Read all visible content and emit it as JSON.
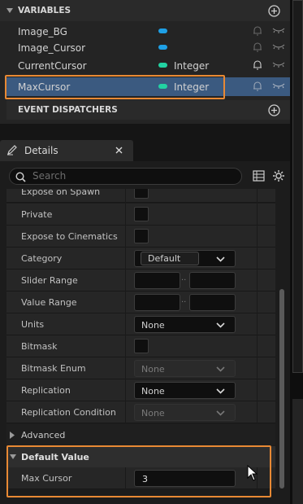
{
  "variables": {
    "header": "VARIABLES",
    "items": [
      {
        "name": "Image_BG",
        "type": "",
        "pill_color": "#1ea0e6"
      },
      {
        "name": "Image_Cursor",
        "type": "",
        "pill_color": "#1ea0e6"
      },
      {
        "name": "CurrentCursor",
        "type": "Integer",
        "pill_color": "#22d2a2"
      },
      {
        "name": "MaxCursor",
        "type": "Integer",
        "pill_color": "#22d2a2"
      }
    ]
  },
  "event_dispatchers": {
    "header": "EVENT DISPATCHERS"
  },
  "details": {
    "tab_label": "Details",
    "search_placeholder": "Search",
    "rows": {
      "expose_on_spawn": "Expose on Spawn",
      "private": "Private",
      "expose_to_cinematics": "Expose to Cinematics",
      "category": "Category",
      "category_value": "Default",
      "slider_range": "Slider Range",
      "value_range": "Value Range",
      "units": "Units",
      "units_value": "None",
      "bitmask": "Bitmask",
      "bitmask_enum": "Bitmask Enum",
      "bitmask_enum_value": "None",
      "replication": "Replication",
      "replication_value": "None",
      "replication_condition": "Replication Condition",
      "replication_condition_value": "None"
    },
    "advanced": "Advanced",
    "default_value": {
      "header": "Default Value",
      "label": "Max Cursor",
      "value": "3"
    },
    "range_separator": ".."
  },
  "colors": {
    "selected": "#3b5a80",
    "highlight": "#e88934"
  }
}
